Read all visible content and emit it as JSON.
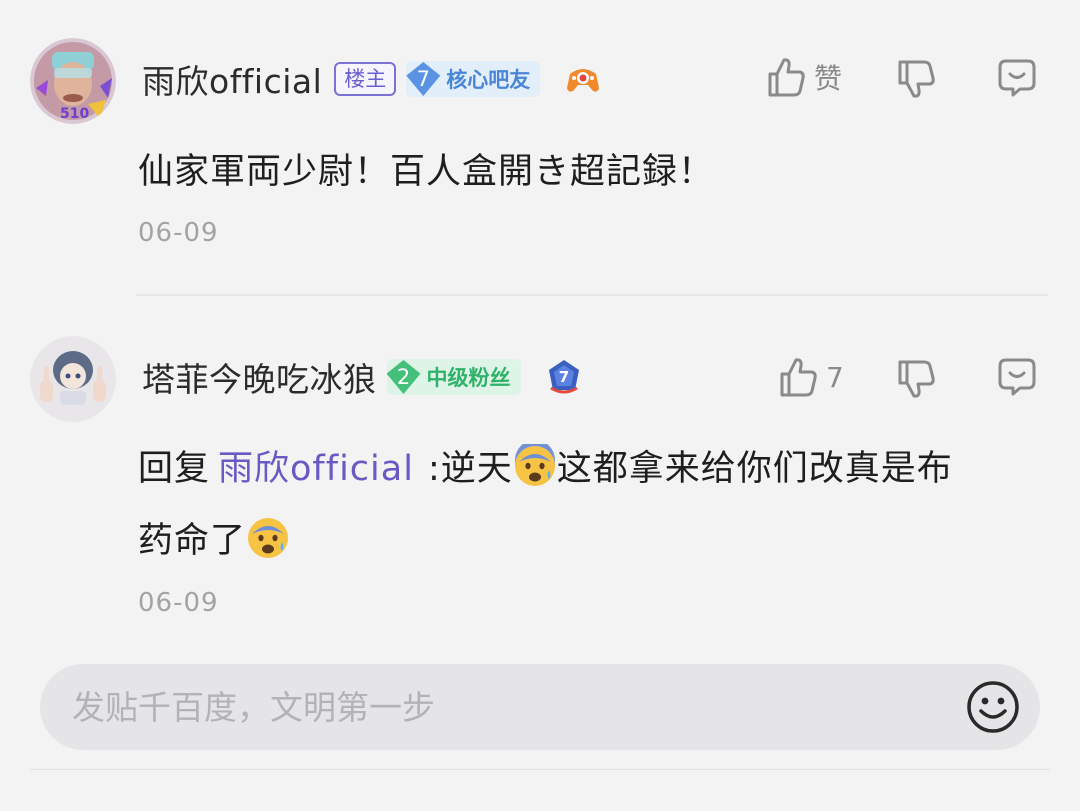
{
  "comments": [
    {
      "username": "雨欣official",
      "owner_badge": "楼主",
      "level": {
        "number": "7",
        "title": "核心吧友"
      },
      "avatar_level": "510",
      "content": "仙家軍両少尉！百人盒開き超記録！",
      "date": "06-09",
      "like_label": "赞"
    },
    {
      "username": "塔菲今晚吃冰狼",
      "level": {
        "number": "2",
        "title": "中级粉丝"
      },
      "medal_number": "7",
      "reply_prefix": "回复",
      "reply_target": "雨欣official",
      "content_part1": ":逆天",
      "content_part2": "这都拿来给你们改真是布",
      "content_line2": "药命了",
      "date": "06-09",
      "like_count": "7"
    }
  ],
  "footer": {
    "input_placeholder": "发贴千百度，文明第一步"
  }
}
